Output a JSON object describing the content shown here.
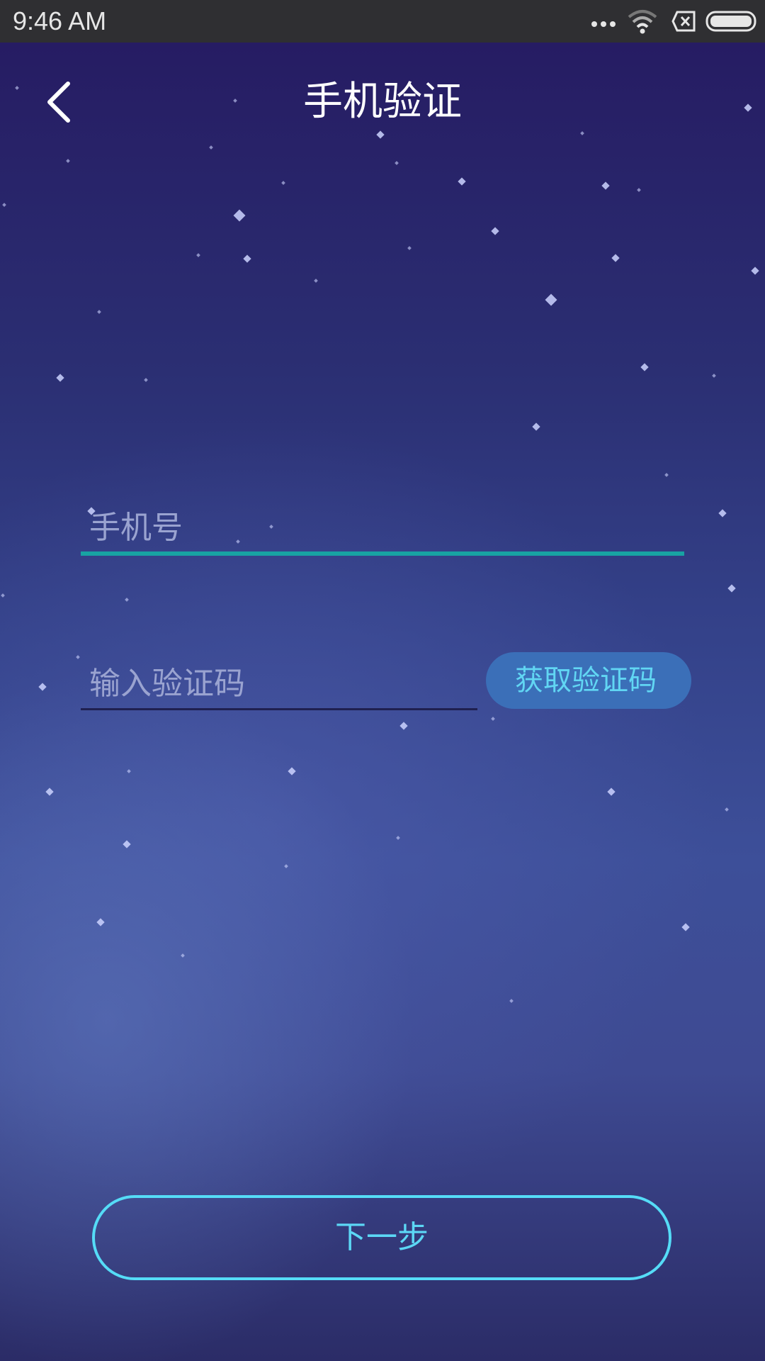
{
  "status_bar": {
    "time": "9:46 AM",
    "icons": [
      "more-dots-icon",
      "wifi-icon",
      "sim-none-icon",
      "battery-icon"
    ]
  },
  "header": {
    "back_icon": "chevron-left-icon",
    "title": "手机验证"
  },
  "form": {
    "phone_placeholder": "手机号",
    "phone_value": "",
    "code_placeholder": "输入验证码",
    "code_value": "",
    "get_code_label": "获取验证码",
    "next_label": "下一步"
  },
  "colors": {
    "accent_cyan": "#55dcf7",
    "phone_underline": "#18a3a3",
    "button_fill": "#3b6fb8"
  }
}
